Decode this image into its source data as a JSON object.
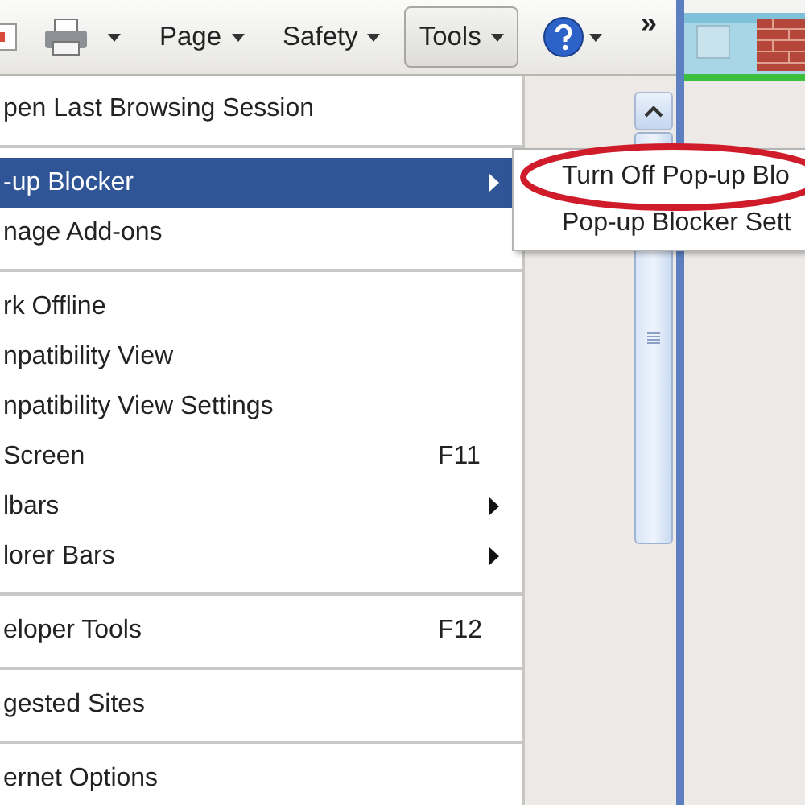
{
  "toolbar": {
    "items": [
      {
        "kind": "page_icon",
        "pressed": false
      },
      {
        "kind": "print",
        "pressed": false
      },
      {
        "kind": "menu",
        "label": "Page",
        "pressed": false
      },
      {
        "kind": "menu",
        "label": "Safety",
        "pressed": false
      },
      {
        "kind": "menu",
        "label": "Tools",
        "pressed": true
      },
      {
        "kind": "help",
        "pressed": false
      }
    ],
    "overflow": "»"
  },
  "menu": {
    "items": [
      {
        "kind": "item",
        "label": "pen Last Browsing Session",
        "selected": false
      },
      {
        "kind": "separator"
      },
      {
        "kind": "item",
        "label": "-up Blocker",
        "submenu": true,
        "selected": true
      },
      {
        "kind": "item",
        "label": "nage Add-ons",
        "selected": false
      },
      {
        "kind": "separator"
      },
      {
        "kind": "item",
        "label": "rk Offline",
        "selected": false
      },
      {
        "kind": "item",
        "label": "npatibility View",
        "selected": false
      },
      {
        "kind": "item",
        "label": "npatibility View Settings",
        "selected": false
      },
      {
        "kind": "item",
        "label": "Screen",
        "shortcut": "F11",
        "selected": false
      },
      {
        "kind": "item",
        "label": "lbars",
        "submenu": true,
        "selected": false
      },
      {
        "kind": "item",
        "label": "lorer Bars",
        "submenu": true,
        "selected": false
      },
      {
        "kind": "separator"
      },
      {
        "kind": "item",
        "label": "eloper Tools",
        "shortcut": "F12",
        "selected": false
      },
      {
        "kind": "separator"
      },
      {
        "kind": "item",
        "label": "gested Sites",
        "selected": false
      },
      {
        "kind": "separator"
      },
      {
        "kind": "item",
        "label": "ernet Options",
        "selected": false
      }
    ]
  },
  "submenu": {
    "items": [
      {
        "label": "Turn Off Pop-up Blo",
        "circled": true
      },
      {
        "label": "Pop-up Blocker Sett",
        "circled": false
      }
    ]
  }
}
